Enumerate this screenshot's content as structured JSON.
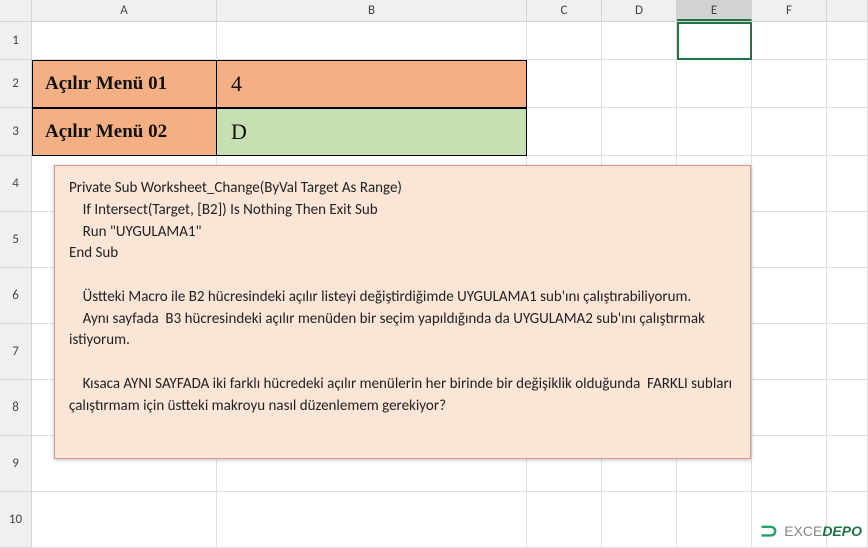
{
  "columns": {
    "A": "A",
    "B": "B",
    "C": "C",
    "D": "D",
    "E": "E",
    "F": "F"
  },
  "rows": {
    "r1": "1",
    "r2": "2",
    "r3": "3",
    "r4": "4",
    "r5": "5",
    "r6": "6",
    "r7": "7",
    "r8": "8",
    "r9": "9",
    "r10": "10"
  },
  "data": {
    "A2": "Açılır Menü 01",
    "B2": "4",
    "A3": "Açılır Menü 02",
    "B3": "D"
  },
  "note": "Private Sub Worksheet_Change(ByVal Target As Range)\n    If Intersect(Target, [B2]) Is Nothing Then Exit Sub\n    Run \"UYGULAMA1\"\nEnd Sub\n\n    Üstteki Macro ile B2 hücresindeki açılır listeyi değiştirdiğimde UYGULAMA1 sub'ını çalıştırabiliyorum.\n    Aynı sayfada  B3 hücresindeki açılır menüden bir seçim yapıldığında da UYGULAMA2 sub'ını çalıştırmak istiyorum.\n\n    Kısaca AYNI SAYFADA iki farklı hücredeki açılır menülerin her birinde bir değişiklik olduğunda  FARKLI subları çalıştırmam için üstteki makroyu nasıl düzenlemem gerekiyor?",
  "watermark": {
    "brand1": "EXCE",
    "brand2": "DEPO"
  },
  "active_cell": "E1"
}
